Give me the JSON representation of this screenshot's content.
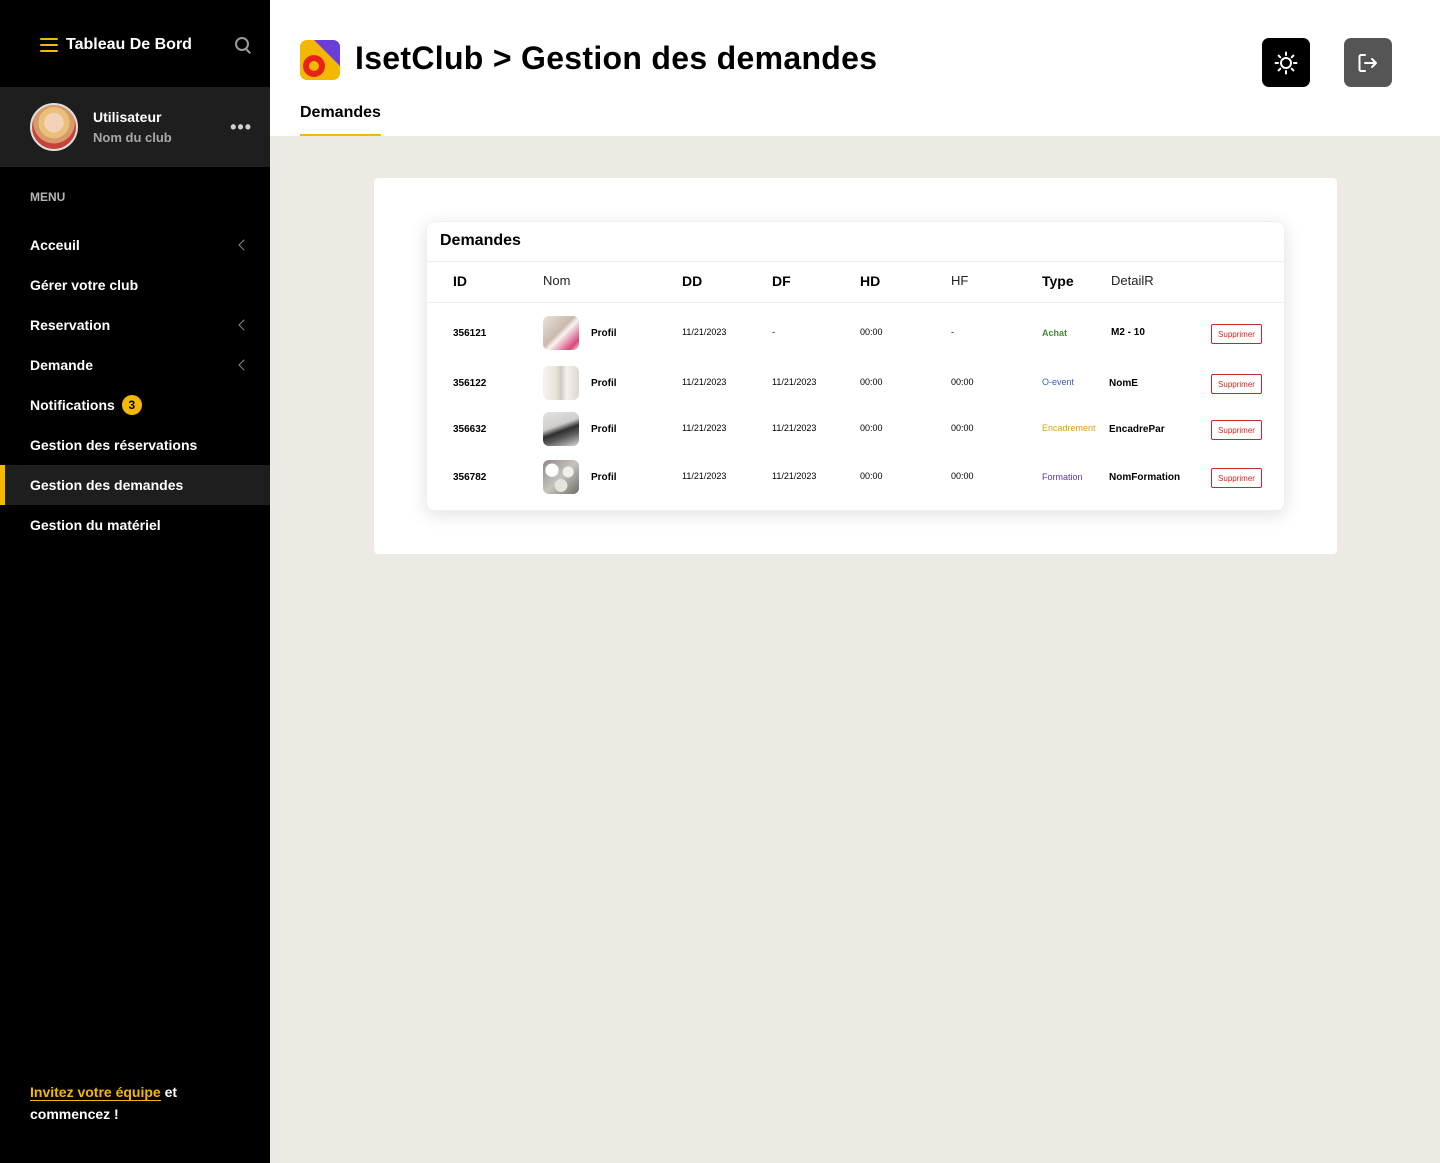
{
  "sidebar": {
    "title": "Tableau De Bord",
    "user": {
      "name": "Utilisateur",
      "club": "Nom du club"
    },
    "menu_label": "MENU",
    "items": [
      {
        "label": "Acceuil"
      },
      {
        "label": "Gérer votre club"
      },
      {
        "label": "Reservation"
      },
      {
        "label": "Demande"
      },
      {
        "label": "Notifications",
        "badge": "3"
      },
      {
        "label": "Gestion des réservations"
      },
      {
        "label": "Gestion des demandes"
      },
      {
        "label": "Gestion du matériel"
      }
    ],
    "invite": {
      "link": "Invitez votre équipe",
      "text1": " et",
      "text2": "commencez !"
    }
  },
  "header": {
    "title": "IsetClub > Gestion des demandes",
    "tab": "Demandes"
  },
  "table": {
    "title": "Demandes",
    "columns": [
      "ID",
      "Nom",
      "DD",
      "DF",
      "HD",
      "HF",
      "Type",
      "DetailR"
    ],
    "rows": [
      {
        "id": "356121",
        "nom": "Profil",
        "dd": "11/21/2023",
        "df": "-",
        "hd": "00:00",
        "hf": "-",
        "type": "Achat",
        "detail": "M2 - 10",
        "action": "Supprimer"
      },
      {
        "id": "356122",
        "nom": "Profil",
        "dd": "11/21/2023",
        "df": "11/21/2023",
        "hd": "00:00",
        "hf": "00:00",
        "type": "O-event",
        "detail": "NomE",
        "action": "Supprimer"
      },
      {
        "id": "356632",
        "nom": "Profil",
        "dd": "11/21/2023",
        "df": "11/21/2023",
        "hd": "00:00",
        "hf": "00:00",
        "type": "Encadrement",
        "detail": "EncadrePar",
        "action": "Supprimer"
      },
      {
        "id": "356782",
        "nom": "Profil",
        "dd": "11/21/2023",
        "df": "11/21/2023",
        "hd": "00:00",
        "hf": "00:00",
        "type": "Formation",
        "detail": "NomFormation",
        "action": "Supprimer"
      }
    ]
  },
  "colors": {
    "accent": "#f5b800",
    "achat": "#4a8a3a",
    "oevent": "#3b5bb5",
    "encadrement": "#d4a017",
    "formation": "#5a3a8a",
    "danger": "#c62828"
  }
}
